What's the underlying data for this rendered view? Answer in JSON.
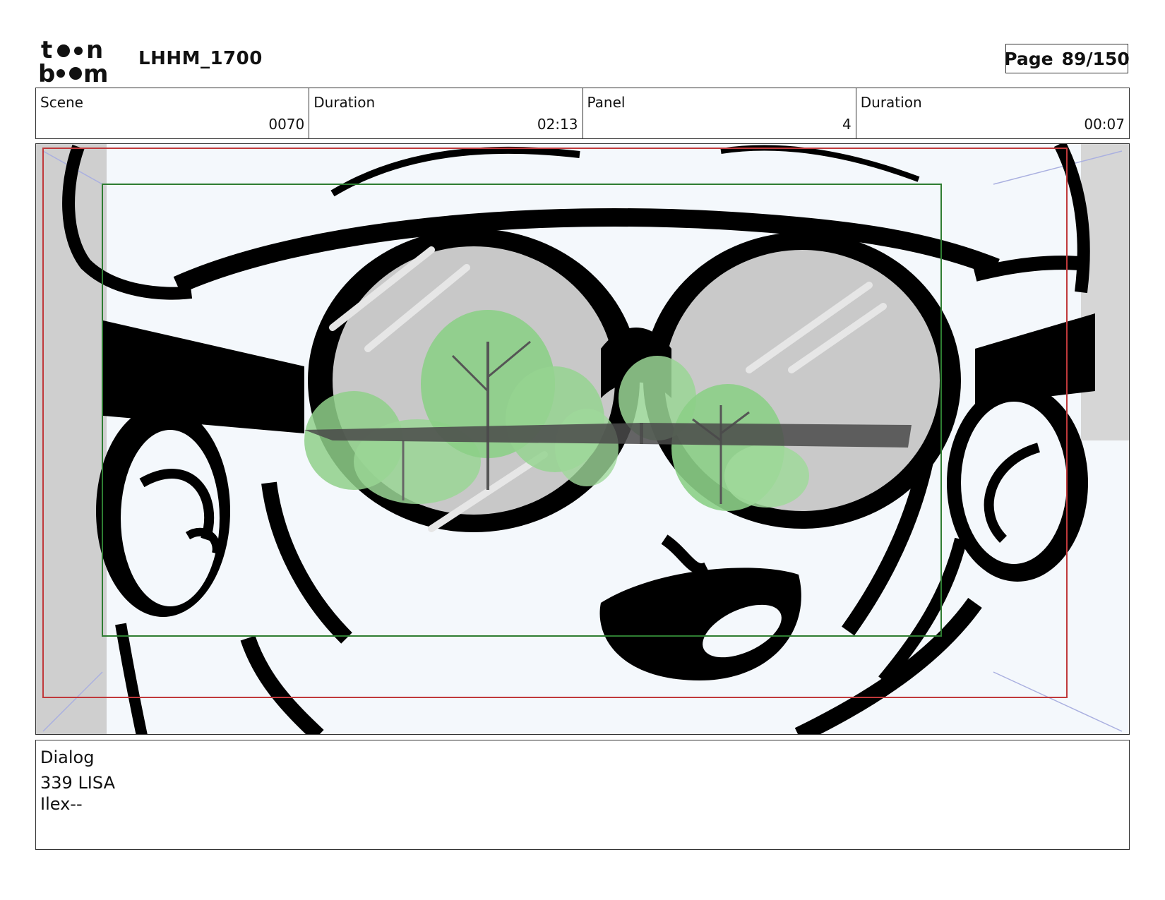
{
  "header": {
    "logo_text": "toon boom",
    "project_title": "LHHM_1700",
    "page_label": "Page",
    "page_number": "89/150"
  },
  "info": {
    "scene_label": "Scene",
    "scene_value": "0070",
    "scene_duration_label": "Duration",
    "scene_duration_value": "02:13",
    "panel_label": "Panel",
    "panel_value": "4",
    "panel_duration_label": "Duration",
    "panel_duration_value": "00:07"
  },
  "dialog": {
    "label": "Dialog",
    "lines": [
      "339 LISA",
      "Ilex--"
    ]
  },
  "colors": {
    "safe_frame_red": "#c0393b",
    "title_safe_green": "#2e7d32",
    "camera_guides_blue": "#aab0e0",
    "panel_bg": "#f4f8fc"
  }
}
